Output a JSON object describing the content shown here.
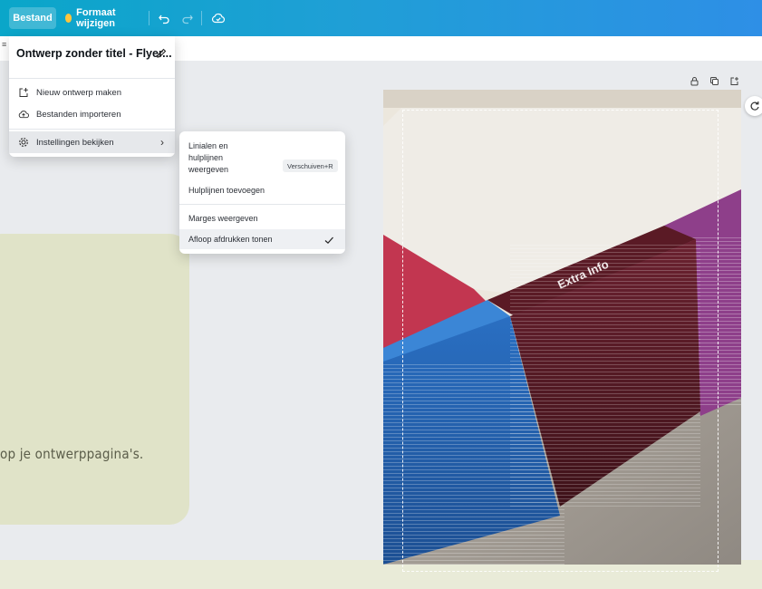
{
  "toolbar": {
    "file_label": "Bestand",
    "resize_label": "Formaat wijzigen",
    "undo_icon": "undo-icon",
    "redo_icon": "redo-icon",
    "save_status_icon": "cloud-check-icon",
    "brand_gradient": [
      "#0aa6c9",
      "#2e8fe6"
    ]
  },
  "file_menu": {
    "design_title": "Ontwerp zonder titel - Flyer...",
    "items": [
      {
        "label": "Nieuw ontwerp maken",
        "icon": "new-design-icon"
      },
      {
        "label": "Bestanden importeren",
        "icon": "cloud-upload-icon"
      },
      {
        "label": "Instellingen bekijken",
        "icon": "gear-icon",
        "active": true
      }
    ]
  },
  "view_submenu": {
    "items": [
      {
        "label": "Linialen en hulplijnen weergeven",
        "lines": [
          "Linialen en",
          "hulplijnen",
          "weergeven"
        ],
        "shortcut": "Verschuiven+R"
      },
      {
        "label": "Hulplijnen toevoegen"
      },
      {
        "label": "Marges weergeven"
      },
      {
        "label": "Afloop afdrukken tonen",
        "checked": true
      }
    ]
  },
  "canvas": {
    "body_text": "op je ontwerppagina's.",
    "card_label": "Extra Info",
    "olive_color": "#e0e3c8"
  }
}
